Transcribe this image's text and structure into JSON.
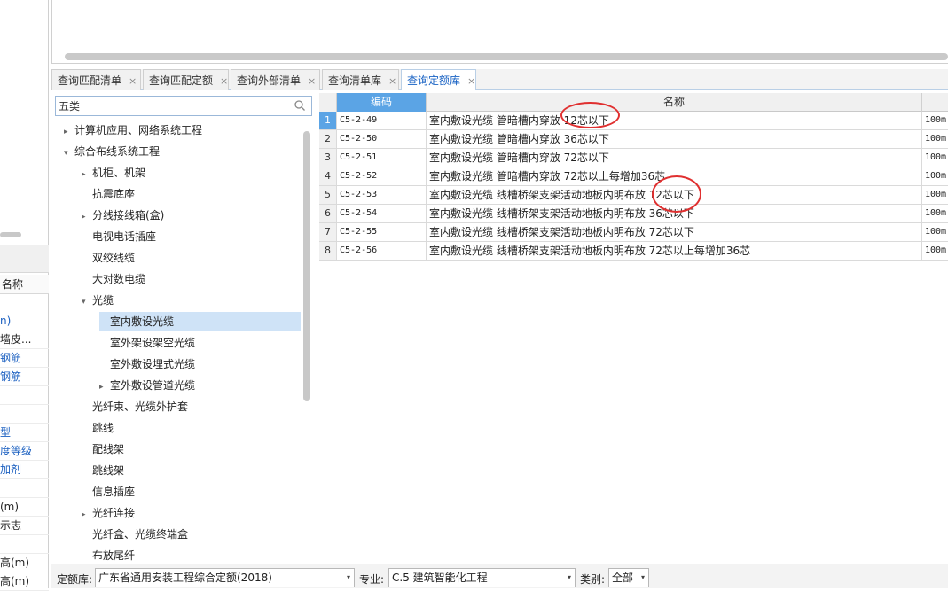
{
  "left_panel": {
    "column_header": "名称",
    "rows": [
      {
        "text": "n)",
        "blue": true
      },
      {
        "text": "墙皮...",
        "blue": false
      },
      {
        "text": "钢筋",
        "blue": true
      },
      {
        "text": "钢筋",
        "blue": true
      },
      {
        "text": "",
        "blue": false
      },
      {
        "text": "",
        "blue": false
      },
      {
        "text": "型",
        "blue": true
      },
      {
        "text": "度等级",
        "blue": true
      },
      {
        "text": "加剂",
        "blue": true
      },
      {
        "text": "",
        "blue": false
      },
      {
        "text": "(m)",
        "blue": false
      },
      {
        "text": "示志",
        "blue": false
      },
      {
        "text": "",
        "blue": false
      },
      {
        "text": "高(m)",
        "blue": false
      },
      {
        "text": "高(m)",
        "blue": false
      }
    ]
  },
  "tabs": [
    {
      "label": "查询匹配清单",
      "close": "×"
    },
    {
      "label": "查询匹配定额",
      "close": "×"
    },
    {
      "label": "查询外部清单",
      "close": "×"
    },
    {
      "label": "查询清单库",
      "close": "×"
    },
    {
      "label": "查询定额库",
      "close": "×",
      "active": true
    }
  ],
  "search": {
    "value": "五类"
  },
  "tree": [
    {
      "label": "计算机应用、网络系统工程",
      "level": 0,
      "arrow": "▸"
    },
    {
      "label": "综合布线系统工程",
      "level": 0,
      "arrow": "▾"
    },
    {
      "label": "机柜、机架",
      "level": 1,
      "arrow": "▸"
    },
    {
      "label": "抗震底座",
      "level": 1,
      "arrow": ""
    },
    {
      "label": "分线接线箱(盒)",
      "level": 1,
      "arrow": "▸"
    },
    {
      "label": "电视电话插座",
      "level": 1,
      "arrow": ""
    },
    {
      "label": "双绞线缆",
      "level": 1,
      "arrow": ""
    },
    {
      "label": "大对数电缆",
      "level": 1,
      "arrow": ""
    },
    {
      "label": "光缆",
      "level": 1,
      "arrow": "▾"
    },
    {
      "label": "室内敷设光缆",
      "level": 2,
      "arrow": "",
      "selected": true
    },
    {
      "label": "室外架设架空光缆",
      "level": 2,
      "arrow": ""
    },
    {
      "label": "室外敷设埋式光缆",
      "level": 2,
      "arrow": ""
    },
    {
      "label": "室外敷设管道光缆",
      "level": 2,
      "arrow": "▸"
    },
    {
      "label": "光纤束、光缆外护套",
      "level": 1,
      "arrow": ""
    },
    {
      "label": "跳线",
      "level": 1,
      "arrow": ""
    },
    {
      "label": "配线架",
      "level": 1,
      "arrow": ""
    },
    {
      "label": "跳线架",
      "level": 1,
      "arrow": ""
    },
    {
      "label": "信息插座",
      "level": 1,
      "arrow": ""
    },
    {
      "label": "光纤连接",
      "level": 1,
      "arrow": "▸"
    },
    {
      "label": "光纤盒、光缆终端盒",
      "level": 1,
      "arrow": ""
    },
    {
      "label": "布放尾纤",
      "level": 1,
      "arrow": ""
    }
  ],
  "grid": {
    "headers": {
      "code": "编码",
      "name": "名称"
    },
    "rows": [
      {
        "num": "1",
        "code": "C5-2-49",
        "name": "室内敷设光缆 管暗槽内穿放 12芯以下",
        "unit": "100m"
      },
      {
        "num": "2",
        "code": "C5-2-50",
        "name": "室内敷设光缆 管暗槽内穿放 36芯以下",
        "unit": "100m"
      },
      {
        "num": "3",
        "code": "C5-2-51",
        "name": "室内敷设光缆 管暗槽内穿放 72芯以下",
        "unit": "100m"
      },
      {
        "num": "4",
        "code": "C5-2-52",
        "name": "室内敷设光缆 管暗槽内穿放 72芯以上每增加36芯",
        "unit": "100m"
      },
      {
        "num": "5",
        "code": "C5-2-53",
        "name": "室内敷设光缆 线槽桥架支架活动地板内明布放 12芯以下",
        "unit": "100m"
      },
      {
        "num": "6",
        "code": "C5-2-54",
        "name": "室内敷设光缆 线槽桥架支架活动地板内明布放 36芯以下",
        "unit": "100m"
      },
      {
        "num": "7",
        "code": "C5-2-55",
        "name": "室内敷设光缆 线槽桥架支架活动地板内明布放 72芯以下",
        "unit": "100m"
      },
      {
        "num": "8",
        "code": "C5-2-56",
        "name": "室内敷设光缆 线槽桥架支架活动地板内明布放 72芯以上每增加36芯",
        "unit": "100m"
      }
    ]
  },
  "bottom": {
    "db_label": "定额库:",
    "db_value": "广东省通用安装工程综合定额(2018)",
    "major_label": "专业:",
    "major_value": "C.5 建筑智能化工程",
    "cat_label": "类别:",
    "cat_value": "全部",
    "dropdown_icon": "▾"
  },
  "colors": {
    "accent": "#5ba4e5",
    "selected_tree": "#cfe3f7",
    "annotation": "#e03030",
    "link_blue": "#1a5fc0"
  }
}
